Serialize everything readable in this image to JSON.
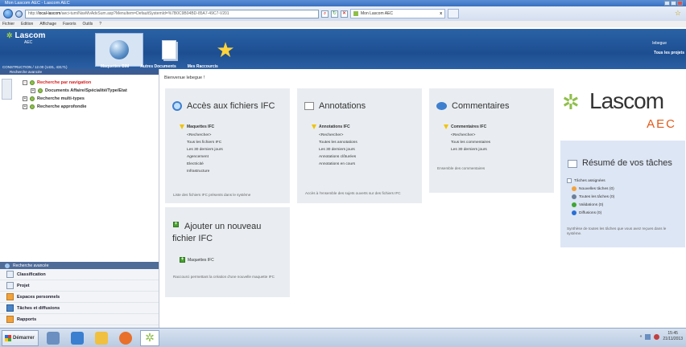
{
  "window": {
    "title": "Mon Lascom AEC - Lascom AEC"
  },
  "browser": {
    "url_prefix": "http://",
    "url_host": "local-lascom",
    "url_rest": "/aeci-tum/NavMvAdvSum.asp?MenuItem=DefaultSystemId=%7B0C9B04BD-85A7-49C7-V201",
    "tab_label": "Mon Lascom AEC",
    "tab_close": "x"
  },
  "menubar": [
    "Fichier",
    "Edition",
    "Affichage",
    "Favoris",
    "Outils",
    "?"
  ],
  "header": {
    "brand": "Lascom",
    "brand_sub": "AEC",
    "user": "lebegue",
    "user_sub": "Tous les projets",
    "context": "CONSTRUCTION / 12.00 (1431, 43171)",
    "nav": [
      "Maquettes BIM",
      "Autres Documents",
      "Mes Raccourcis"
    ]
  },
  "left_panel": {
    "header": "Recherche avancée",
    "tree": [
      {
        "label": "Recherche par navigation",
        "style": "red"
      },
      {
        "label": "Documents Affaire/Spécialité/Type/Etat",
        "style": "indent"
      },
      {
        "label": "Recherche multi-types",
        "style": ""
      },
      {
        "label": "Recherche approfondie",
        "style": ""
      }
    ],
    "bottom_header": "Recherche avancée",
    "bottom_items": [
      {
        "label": "Classification",
        "icon": "list-icon"
      },
      {
        "label": "Projet",
        "icon": "project-icon"
      },
      {
        "label": "Espaces personnels",
        "icon": "folder-icon"
      },
      {
        "label": "Tâches et diffusions",
        "icon": "tasks-icon"
      },
      {
        "label": "Rapports",
        "icon": "report-icon"
      }
    ]
  },
  "main": {
    "welcome": "Bienvenue lebegue !",
    "ifc": {
      "title": "Accès aux fichiers IFC",
      "section": "Maquettes IFC",
      "items": [
        "<Rechercher>",
        "Tous les fichiers IFC",
        "Les 30 derniers jours",
        "Agencement",
        "Electricité",
        "Infrastructure"
      ],
      "desc": "Liste des fichiers IFC présents dans le système"
    },
    "annotations": {
      "title": "Annotations",
      "section": "Annotations IFC",
      "items": [
        "<Rechercher>",
        "Toutes les annotations",
        "Les 30 derniers jours",
        "Annotations clôturées",
        "Annotations en cours"
      ],
      "desc": "Accès à l'ensemble des sujets ouverts sur des fichiers IFC"
    },
    "comments": {
      "title": "Commentaires",
      "section": "Commentaires IFC",
      "items": [
        "<Rechercher>",
        "Tous les commentaires",
        "Les 30 derniers jours"
      ],
      "desc": "Ensemble des commentaires"
    },
    "add": {
      "title_line1": "Ajouter un nouveau",
      "title_line2": "fichier IFC",
      "item": "Maquettes IFC",
      "desc": "Raccourci permettant la création d'une nouvelle maquette IFC"
    },
    "logo": {
      "text": "Lascom",
      "sub": "AEC"
    },
    "resume": {
      "title": "Résumé de vos tâches",
      "section": "Tâches assignées",
      "items": [
        {
          "label": "Nouvelles tâches (0)",
          "color": "#f2a23b"
        },
        {
          "label": "Toutes les tâches (0)",
          "color": "#6b7f99"
        },
        {
          "label": "Validations (0)",
          "color": "#3fa535"
        },
        {
          "label": "Diffusions (0)",
          "color": "#2a6fd6"
        }
      ],
      "desc": "Synthèse de toutes les tâches que vous avez reçues dans le système."
    }
  },
  "taskbar": {
    "start": "Démarrer",
    "time": "15:45",
    "date": "21/11/2013"
  }
}
